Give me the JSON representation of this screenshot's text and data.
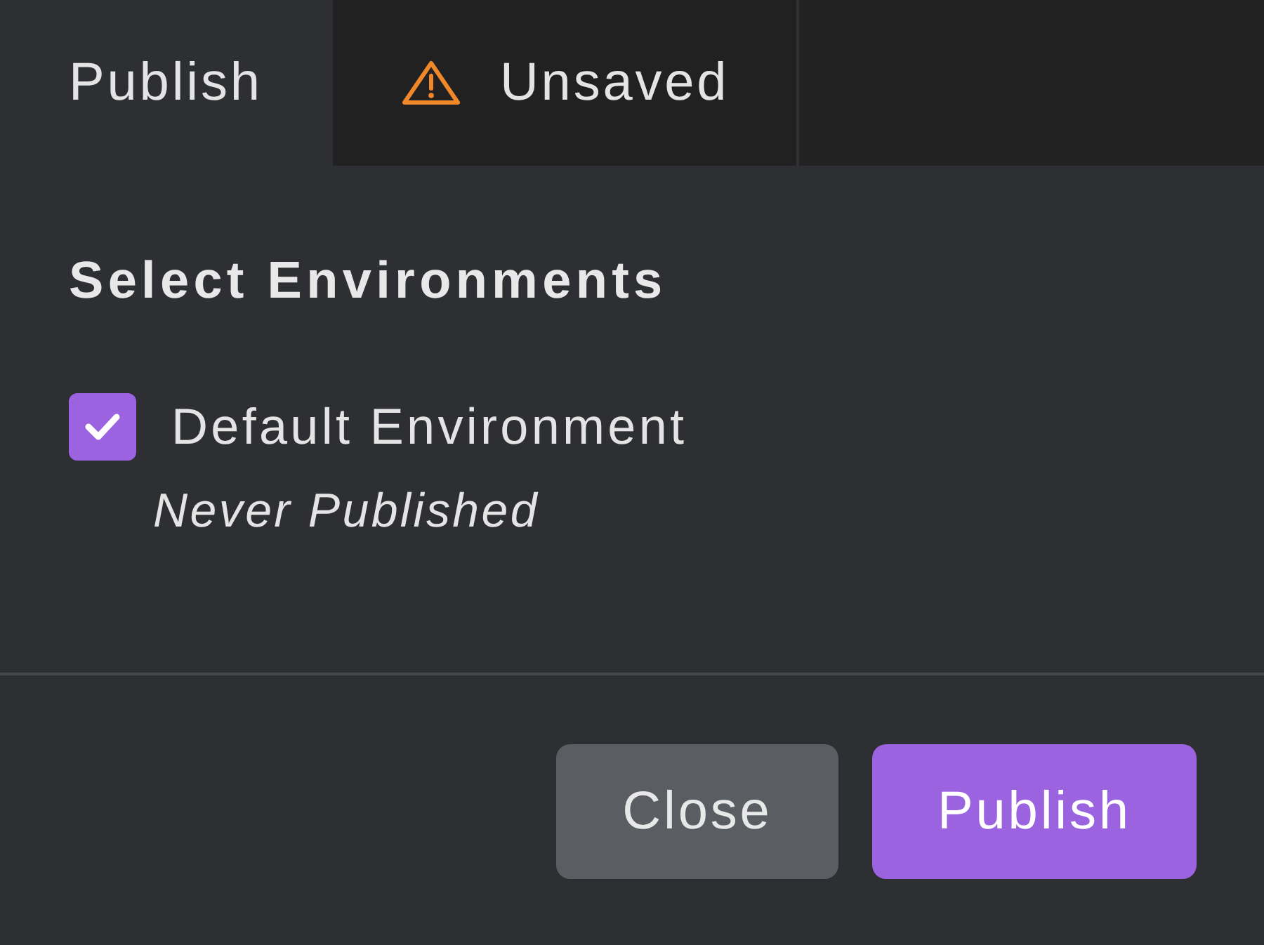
{
  "tabs": [
    {
      "label": "Publish",
      "selected": true,
      "warning": false
    },
    {
      "label": "Unsaved",
      "selected": false,
      "warning": true
    }
  ],
  "section": {
    "title": "Select Environments"
  },
  "environments": [
    {
      "label": "Default Environment",
      "checked": true,
      "status": "Never Published"
    }
  ],
  "buttons": [
    {
      "label": "Close",
      "kind": "secondary"
    },
    {
      "label": "Publish",
      "kind": "primary"
    }
  ]
}
